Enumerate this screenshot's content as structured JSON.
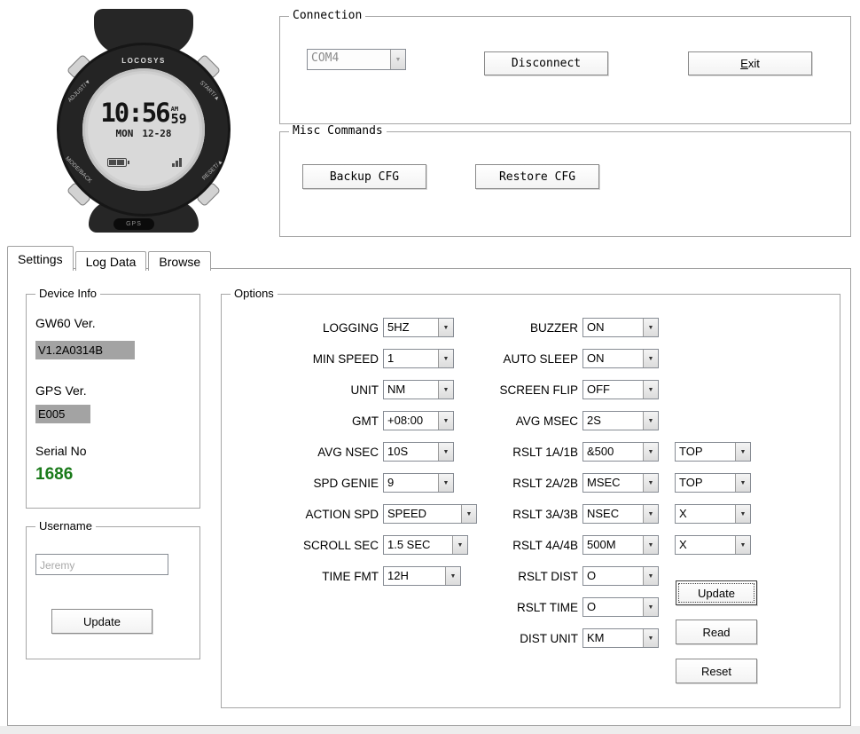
{
  "watch": {
    "brand": "LOCOSYS",
    "time": "10:56",
    "seconds": "59",
    "meridiem": "AM",
    "day": "MON",
    "date": "12-28",
    "bezel_labels": {
      "top_left": "ADJUST/▼",
      "top_right": "START/▲",
      "bottom_left": "MODE/BACK",
      "bottom_right": "RESET/▲"
    },
    "gps_label": "GPS"
  },
  "connection": {
    "title": "Connection",
    "com_port": "COM4",
    "disconnect_label": "Disconnect",
    "exit_accel": "E",
    "exit_rest": "xit"
  },
  "misc": {
    "title": "Misc Commands",
    "backup_label": "Backup CFG",
    "restore_label": "Restore CFG"
  },
  "tabs": {
    "settings": "Settings",
    "log_data": "Log Data",
    "browse": "Browse"
  },
  "device_info": {
    "title": "Device Info",
    "fw_label": "GW60 Ver.",
    "fw_value": "V1.2A0314B",
    "gps_label": "GPS Ver.",
    "gps_value": "E005",
    "serial_label": "Serial No",
    "serial_value": "1686",
    "serial_color": "#1a7a1a",
    "value_box_color": "#a3a3a3"
  },
  "username": {
    "title": "Username",
    "value": "Jeremy",
    "update_label": "Update"
  },
  "options": {
    "title": "Options",
    "left": [
      {
        "label": "LOGGING",
        "value": "5HZ"
      },
      {
        "label": "MIN SPEED",
        "value": "1"
      },
      {
        "label": "UNIT",
        "value": "NM"
      },
      {
        "label": "GMT",
        "value": "+08:00"
      },
      {
        "label": "AVG NSEC",
        "value": "10S"
      },
      {
        "label": "SPD GENIE",
        "value": "9"
      },
      {
        "label": "ACTION SPD",
        "value": "SPEED"
      },
      {
        "label": "SCROLL SEC",
        "value": "1.5 SEC"
      },
      {
        "label": "TIME FMT",
        "value": "12H"
      }
    ],
    "right": [
      {
        "label": "BUZZER",
        "value": "ON"
      },
      {
        "label": "AUTO SLEEP",
        "value": "ON"
      },
      {
        "label": "SCREEN FLIP",
        "value": "OFF"
      },
      {
        "label": "AVG MSEC",
        "value": "2S"
      },
      {
        "label": "RSLT 1A/1B",
        "value": "&500",
        "value2": "TOP"
      },
      {
        "label": "RSLT 2A/2B",
        "value": "MSEC",
        "value2": "TOP"
      },
      {
        "label": "RSLT 3A/3B",
        "value": "NSEC",
        "value2": "X"
      },
      {
        "label": "RSLT 4A/4B",
        "value": "500M",
        "value2": "X"
      },
      {
        "label": "RSLT DIST",
        "value": "O"
      },
      {
        "label": "RSLT TIME",
        "value": "O"
      },
      {
        "label": "DIST UNIT",
        "value": "KM"
      }
    ],
    "update_label": "Update",
    "read_label": "Read",
    "reset_label": "Reset"
  }
}
